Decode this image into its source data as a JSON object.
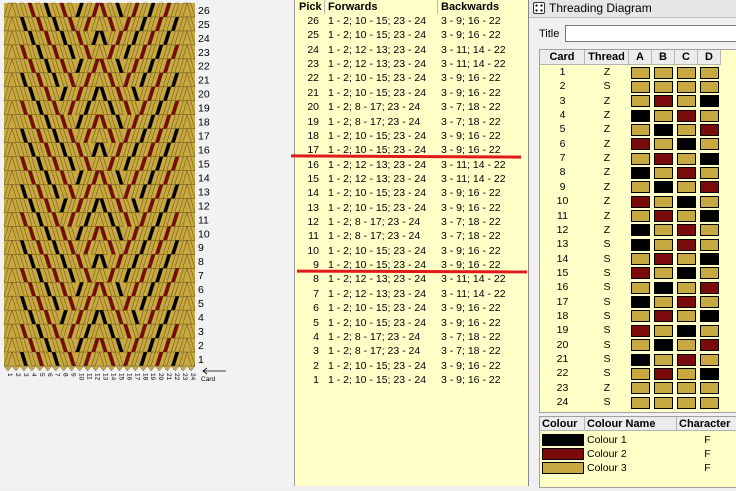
{
  "colors": {
    "c1": "#000000",
    "c2": "#7b0a0a",
    "c3": "#c8a840",
    "bg_pick": "#ffffc8"
  },
  "weave": {
    "pick_labels": [
      "26",
      "25",
      "24",
      "23",
      "22",
      "21",
      "20",
      "19",
      "18",
      "17",
      "16",
      "15",
      "14",
      "13",
      "12",
      "11",
      "10",
      "9",
      "8",
      "7",
      "6",
      "5",
      "4",
      "3",
      "2",
      "1"
    ],
    "card_numbers": [
      "1",
      "2",
      "3",
      "4",
      "5",
      "6",
      "7",
      "8",
      "9",
      "10",
      "11",
      "12",
      "13",
      "14",
      "15",
      "16",
      "17",
      "18",
      "19",
      "20",
      "21",
      "22",
      "23",
      "24"
    ],
    "card_label": "Card"
  },
  "picks": {
    "headers": {
      "pick": "Pick",
      "forwards": "Forwards",
      "backwards": "Backwards"
    },
    "rows": [
      {
        "pick": "26",
        "fwd": "1 - 2; 10 - 15; 23 - 24",
        "bwd": "3 - 9; 16 - 22"
      },
      {
        "pick": "25",
        "fwd": "1 - 2; 10 - 15; 23 - 24",
        "bwd": "3 - 9; 16 - 22"
      },
      {
        "pick": "24",
        "fwd": "1 - 2; 12 - 13; 23 - 24",
        "bwd": "3 - 11; 14 - 22"
      },
      {
        "pick": "23",
        "fwd": "1 - 2; 12 - 13; 23 - 24",
        "bwd": "3 - 11; 14 - 22"
      },
      {
        "pick": "22",
        "fwd": "1 - 2; 10 - 15; 23 - 24",
        "bwd": "3 - 9; 16 - 22"
      },
      {
        "pick": "21",
        "fwd": "1 - 2; 10 - 15; 23 - 24",
        "bwd": "3 - 9; 16 - 22"
      },
      {
        "pick": "20",
        "fwd": "1 - 2; 8 - 17; 23 - 24",
        "bwd": "3 - 7; 18 - 22"
      },
      {
        "pick": "19",
        "fwd": "1 - 2; 8 - 17; 23 - 24",
        "bwd": "3 - 7; 18 - 22"
      },
      {
        "pick": "18",
        "fwd": "1 - 2; 10 - 15; 23 - 24",
        "bwd": "3 - 9; 16 - 22"
      },
      {
        "pick": "17",
        "fwd": "1 - 2; 10 - 15; 23 - 24",
        "bwd": "3 - 9; 16 - 22"
      },
      {
        "pick": "16",
        "fwd": "1 - 2; 12 - 13; 23 - 24",
        "bwd": "3 - 11; 14 - 22"
      },
      {
        "pick": "15",
        "fwd": "1 - 2; 12 - 13; 23 - 24",
        "bwd": "3 - 11; 14 - 22"
      },
      {
        "pick": "14",
        "fwd": "1 - 2; 10 - 15; 23 - 24",
        "bwd": "3 - 9; 16 - 22"
      },
      {
        "pick": "13",
        "fwd": "1 - 2; 10 - 15; 23 - 24",
        "bwd": "3 - 9; 16 - 22"
      },
      {
        "pick": "12",
        "fwd": "1 - 2; 8 - 17; 23 - 24",
        "bwd": "3 - 7; 18 - 22"
      },
      {
        "pick": "11",
        "fwd": "1 - 2; 8 - 17; 23 - 24",
        "bwd": "3 - 7; 18 - 22"
      },
      {
        "pick": "10",
        "fwd": "1 - 2; 10 - 15; 23 - 24",
        "bwd": "3 - 9; 16 - 22"
      },
      {
        "pick": "9",
        "fwd": "1 - 2; 10 - 15; 23 - 24",
        "bwd": "3 - 9; 16 - 22"
      },
      {
        "pick": "8",
        "fwd": "1 - 2; 12 - 13; 23 - 24",
        "bwd": "3 - 11; 14 - 22"
      },
      {
        "pick": "7",
        "fwd": "1 - 2; 12 - 13; 23 - 24",
        "bwd": "3 - 11; 14 - 22"
      },
      {
        "pick": "6",
        "fwd": "1 - 2; 10 - 15; 23 - 24",
        "bwd": "3 - 9; 16 - 22"
      },
      {
        "pick": "5",
        "fwd": "1 - 2; 10 - 15; 23 - 24",
        "bwd": "3 - 9; 16 - 22"
      },
      {
        "pick": "4",
        "fwd": "1 - 2; 8 - 17; 23 - 24",
        "bwd": "3 - 7; 18 - 22"
      },
      {
        "pick": "3",
        "fwd": "1 - 2; 8 - 17; 23 - 24",
        "bwd": "3 - 7; 18 - 22"
      },
      {
        "pick": "2",
        "fwd": "1 - 2; 10 - 15; 23 - 24",
        "bwd": "3 - 9; 16 - 22"
      },
      {
        "pick": "1",
        "fwd": "1 - 2; 10 - 15; 23 - 24",
        "bwd": "3 - 9; 16 - 22"
      }
    ]
  },
  "threading": {
    "window_title": "Threading Diagram",
    "title_label": "Title",
    "title_value": "",
    "headers": {
      "card": "Card",
      "thread": "Thread",
      "a": "A",
      "b": "B",
      "c": "C",
      "d": "D"
    },
    "rows": [
      {
        "card": "1",
        "thread": "Z",
        "holes": [
          3,
          3,
          3,
          3
        ]
      },
      {
        "card": "2",
        "thread": "S",
        "holes": [
          3,
          3,
          3,
          3
        ]
      },
      {
        "card": "3",
        "thread": "Z",
        "holes": [
          3,
          2,
          3,
          1
        ]
      },
      {
        "card": "4",
        "thread": "Z",
        "holes": [
          1,
          3,
          2,
          3
        ]
      },
      {
        "card": "5",
        "thread": "Z",
        "holes": [
          3,
          1,
          3,
          2
        ]
      },
      {
        "card": "6",
        "thread": "Z",
        "holes": [
          2,
          3,
          1,
          3
        ]
      },
      {
        "card": "7",
        "thread": "Z",
        "holes": [
          3,
          2,
          3,
          1
        ]
      },
      {
        "card": "8",
        "thread": "Z",
        "holes": [
          1,
          3,
          2,
          3
        ]
      },
      {
        "card": "9",
        "thread": "Z",
        "holes": [
          3,
          1,
          3,
          2
        ]
      },
      {
        "card": "10",
        "thread": "Z",
        "holes": [
          2,
          3,
          1,
          3
        ]
      },
      {
        "card": "11",
        "thread": "Z",
        "holes": [
          3,
          2,
          3,
          1
        ]
      },
      {
        "card": "12",
        "thread": "Z",
        "holes": [
          1,
          3,
          2,
          3
        ]
      },
      {
        "card": "13",
        "thread": "S",
        "holes": [
          1,
          3,
          2,
          3
        ]
      },
      {
        "card": "14",
        "thread": "S",
        "holes": [
          3,
          2,
          3,
          1
        ]
      },
      {
        "card": "15",
        "thread": "S",
        "holes": [
          2,
          3,
          1,
          3
        ]
      },
      {
        "card": "16",
        "thread": "S",
        "holes": [
          3,
          1,
          3,
          2
        ]
      },
      {
        "card": "17",
        "thread": "S",
        "holes": [
          1,
          3,
          2,
          3
        ]
      },
      {
        "card": "18",
        "thread": "S",
        "holes": [
          3,
          2,
          3,
          1
        ]
      },
      {
        "card": "19",
        "thread": "S",
        "holes": [
          2,
          3,
          1,
          3
        ]
      },
      {
        "card": "20",
        "thread": "S",
        "holes": [
          3,
          1,
          3,
          2
        ]
      },
      {
        "card": "21",
        "thread": "S",
        "holes": [
          1,
          3,
          2,
          3
        ]
      },
      {
        "card": "22",
        "thread": "S",
        "holes": [
          3,
          2,
          3,
          1
        ]
      },
      {
        "card": "23",
        "thread": "Z",
        "holes": [
          3,
          3,
          3,
          3
        ]
      },
      {
        "card": "24",
        "thread": "S",
        "holes": [
          3,
          3,
          3,
          3
        ]
      }
    ],
    "legend": {
      "headers": {
        "colour": "Colour",
        "name": "Colour Name",
        "character": "Character"
      },
      "rows": [
        {
          "color": "#000000",
          "name": "Colour 1",
          "char": "F"
        },
        {
          "color": "#7b0a0a",
          "name": "Colour 2",
          "char": "F"
        },
        {
          "color": "#c8a840",
          "name": "Colour 3",
          "char": "F"
        }
      ]
    }
  }
}
